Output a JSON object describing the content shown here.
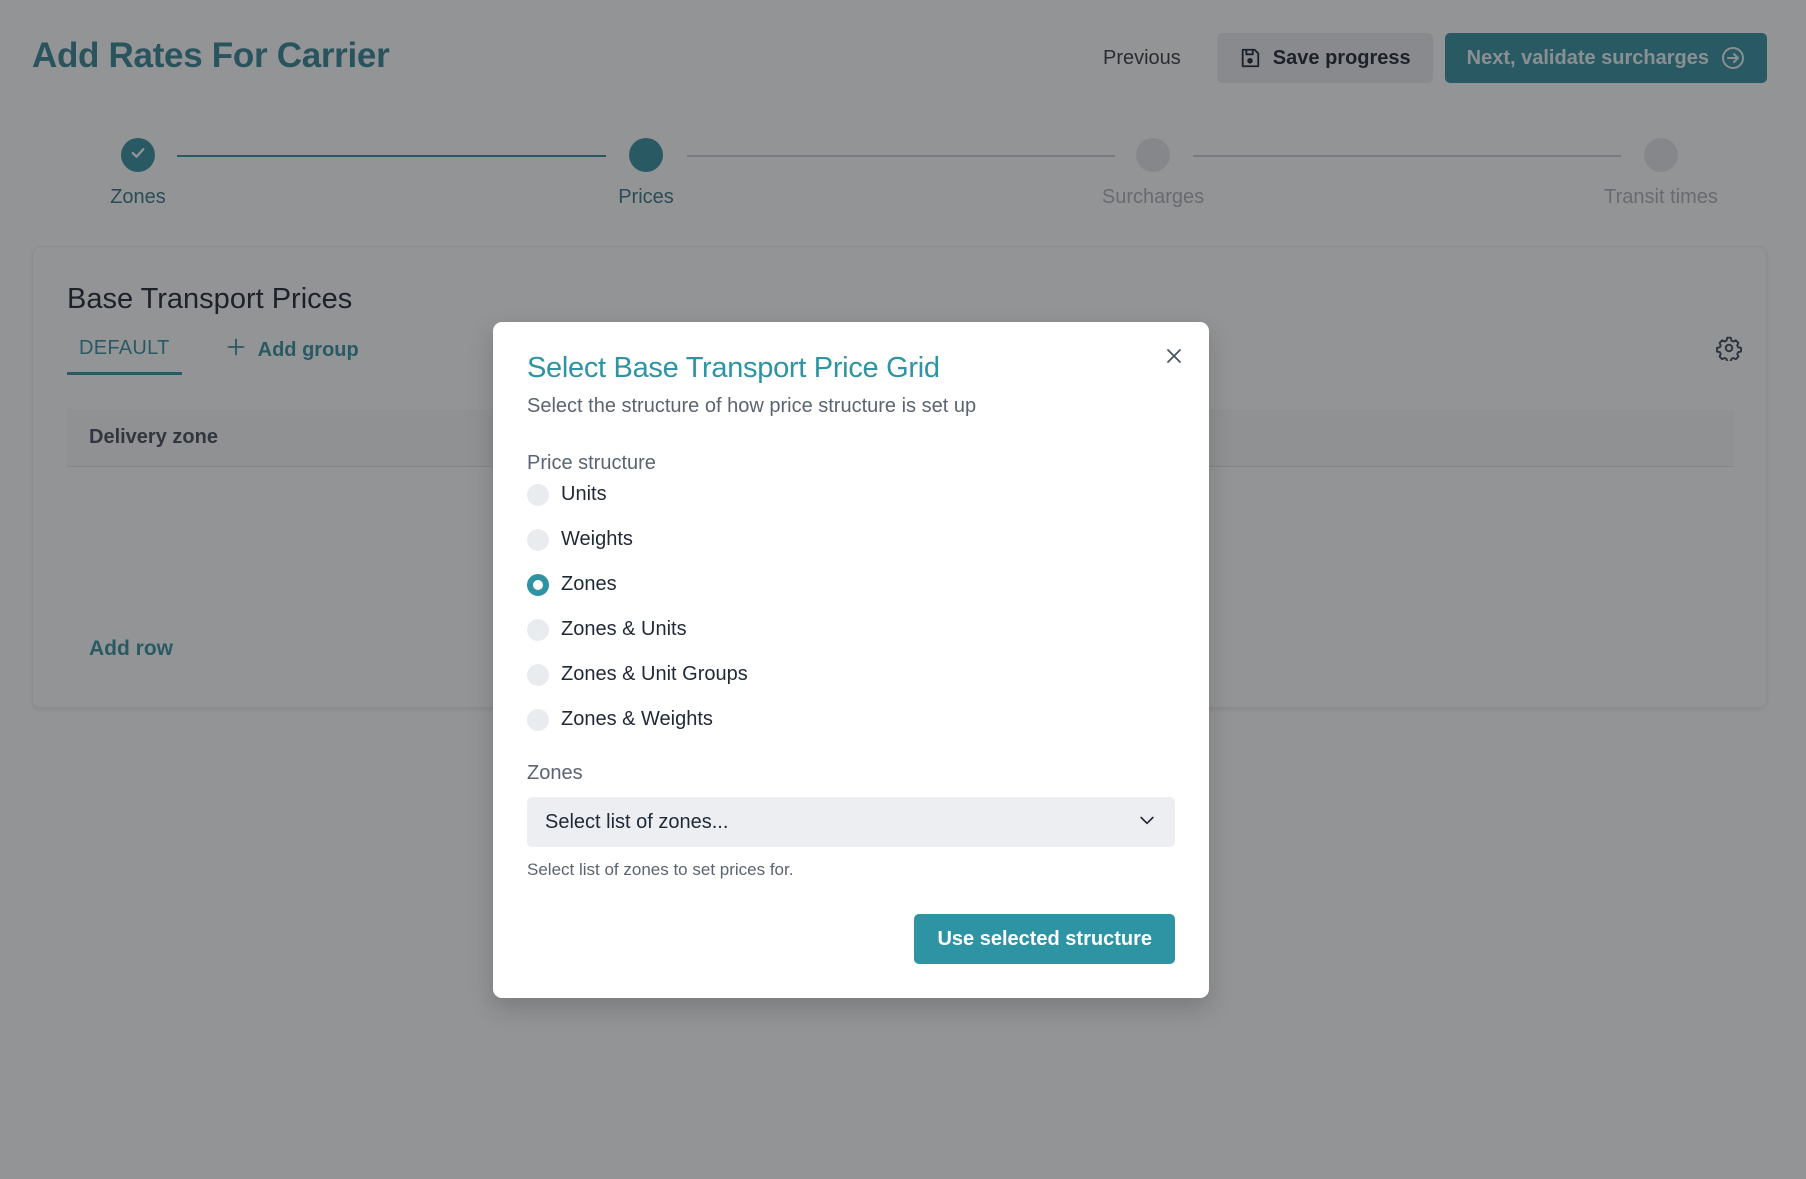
{
  "page": {
    "title": "Add Rates For Carrier"
  },
  "header": {
    "previous_label": "Previous",
    "save_label": "Save progress",
    "next_label": "Next, validate surcharges"
  },
  "stepper": {
    "steps": [
      {
        "label": "Zones",
        "state": "done"
      },
      {
        "label": "Prices",
        "state": "active"
      },
      {
        "label": "Surcharges",
        "state": "pending"
      },
      {
        "label": "Transit times",
        "state": "pending"
      }
    ]
  },
  "card": {
    "title": "Base Transport Prices",
    "tabs": [
      {
        "label": "DEFAULT",
        "active": true
      }
    ],
    "add_group_label": "Add group",
    "table": {
      "columns": [
        "Delivery zone"
      ],
      "rows": []
    },
    "add_row_label": "Add row"
  },
  "modal": {
    "title": "Select Base Transport Price Grid",
    "subtitle": "Select the structure of how price structure is set up",
    "price_structure_label": "Price structure",
    "options": [
      {
        "label": "Units",
        "checked": false
      },
      {
        "label": "Weights",
        "checked": false
      },
      {
        "label": "Zones",
        "checked": true
      },
      {
        "label": "Zones & Units",
        "checked": false
      },
      {
        "label": "Zones & Unit Groups",
        "checked": false
      },
      {
        "label": "Zones & Weights",
        "checked": false
      }
    ],
    "zones_label": "Zones",
    "zones_select_placeholder": "Select list of zones...",
    "zones_help": "Select list of zones to set prices for.",
    "submit_label": "Use selected structure"
  },
  "colors": {
    "accent": "#2e94a3",
    "accent_dark": "#2b7d8c",
    "overlay": "rgba(40,42,46,0.5)"
  }
}
